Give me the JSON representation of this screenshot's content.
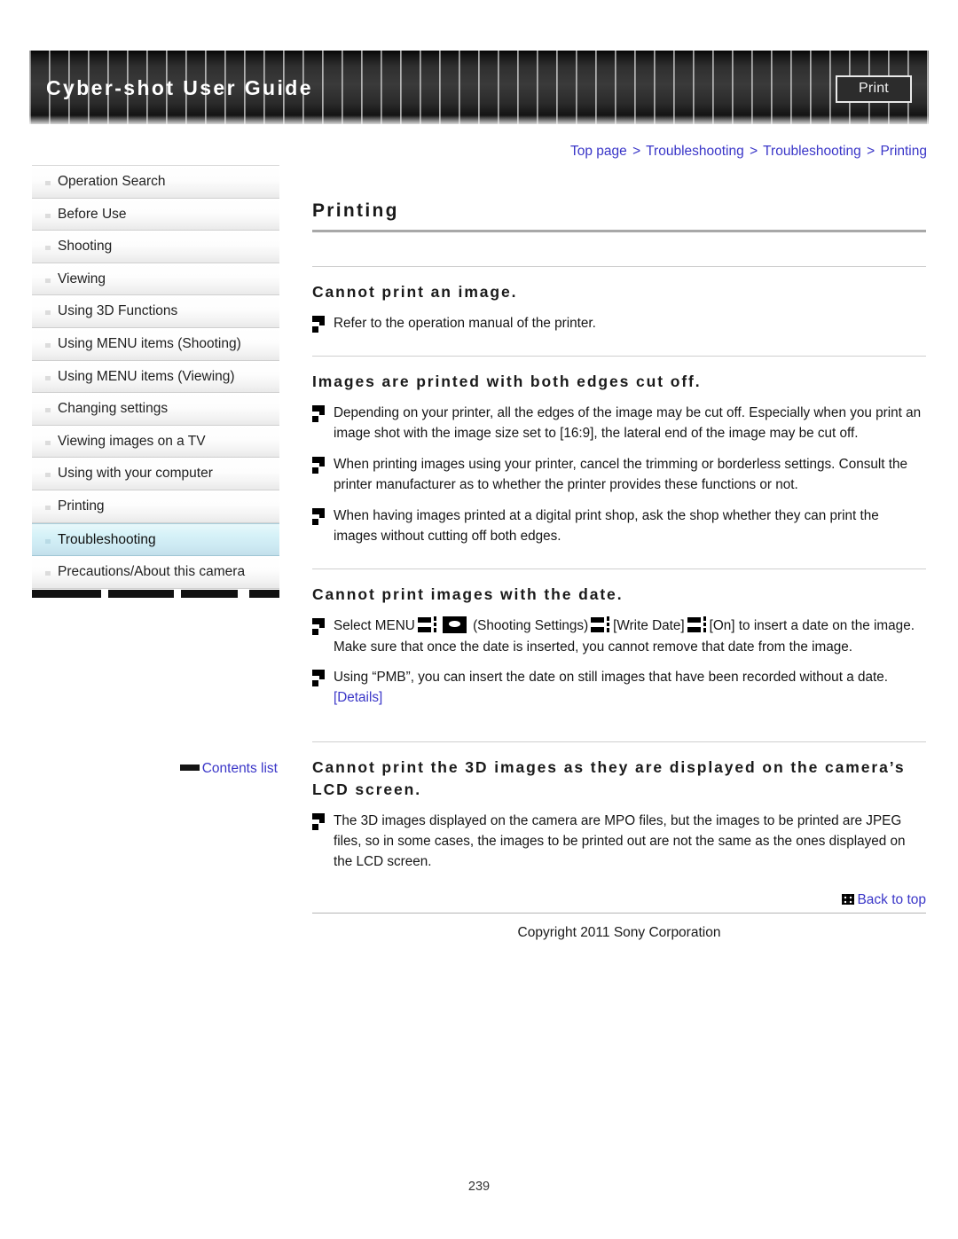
{
  "header": {
    "title": "Cyber-shot User Guide",
    "print_label": "Print"
  },
  "breadcrumb": {
    "items": [
      "Top page",
      "Troubleshooting",
      "Troubleshooting",
      "Printing"
    ],
    "separator": ">"
  },
  "sidebar": {
    "items": [
      {
        "label": "Operation Search",
        "selected": false
      },
      {
        "label": "Before Use",
        "selected": false
      },
      {
        "label": "Shooting",
        "selected": false
      },
      {
        "label": "Viewing",
        "selected": false
      },
      {
        "label": "Using 3D Functions",
        "selected": false
      },
      {
        "label": "Using MENU items (Shooting)",
        "selected": false
      },
      {
        "label": "Using MENU items (Viewing)",
        "selected": false
      },
      {
        "label": "Changing settings",
        "selected": false
      },
      {
        "label": "Viewing images on a TV",
        "selected": false
      },
      {
        "label": "Using with your computer",
        "selected": false
      },
      {
        "label": "Printing",
        "selected": false
      },
      {
        "label": "Troubleshooting",
        "selected": true
      },
      {
        "label": "Precautions/About this camera",
        "selected": false
      }
    ],
    "contents_list_label": "Contents list"
  },
  "main": {
    "page_title": "Printing",
    "sections": [
      {
        "heading": "Cannot print an image.",
        "paragraphs": [
          "Refer to the operation manual of the printer."
        ]
      },
      {
        "heading": "Images are printed with both edges cut off.",
        "paragraphs": [
          "Depending on your printer, all the edges of the image may be cut off. Especially when you print an image shot with the image size set to [16:9], the lateral end of the image may be cut off.",
          "When printing images using your printer, cancel the trimming or borderless settings. Consult the printer manufacturer as to whether the printer provides these functions or not.",
          "When having images printed at a digital print shop, ask the shop whether they can print the images without cutting off both edges."
        ]
      },
      {
        "heading": "Cannot print images with the date.",
        "menu_para": {
          "t1": "Select MENU",
          "t2": "(Shooting Settings)",
          "t3": "[Write Date]",
          "t4": "[On] to insert a date on the image. Make sure that once the date is inserted, you cannot remove that date from the image."
        },
        "pmb_para": {
          "text": "Using “PMB”, you can insert the date on still images that have been recorded without a date.",
          "link": "[Details]"
        }
      },
      {
        "heading": "Cannot print the 3D images as they are displayed on the camera’s LCD screen.",
        "paragraphs": [
          "The 3D images displayed on the camera are MPO files, but the images to be printed are JPEG files, so in some cases, the images to be printed out are not the same as the ones displayed on the LCD screen."
        ]
      }
    ]
  },
  "footer": {
    "back_to_top": "Back to top",
    "copyright": "Copyright 2011 Sony Corporation",
    "page_number": "239"
  },
  "colors": {
    "link": "#3a36c8",
    "selected_nav": "#cdeaf3",
    "banner_dark": "#2f2f2f"
  }
}
